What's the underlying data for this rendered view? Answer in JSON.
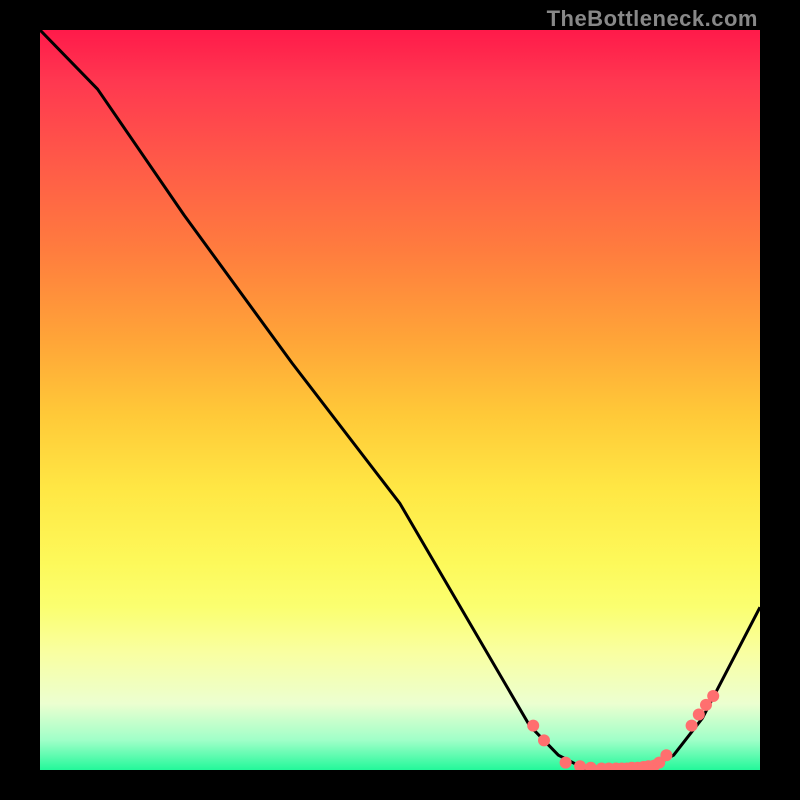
{
  "branding": "TheBottleneck.com",
  "chart_data": {
    "type": "line",
    "title": "",
    "xlabel": "",
    "ylabel": "",
    "xlim": [
      0,
      100
    ],
    "ylim": [
      0,
      100
    ],
    "series": [
      {
        "name": "bottleneck-curve",
        "x": [
          0,
          8,
          20,
          35,
          50,
          68,
          72,
          76,
          80,
          84,
          88,
          92,
          100
        ],
        "y": [
          100,
          92,
          75,
          55,
          36,
          6,
          2,
          0,
          0,
          0,
          2,
          7,
          22
        ]
      }
    ],
    "markers": {
      "name": "highlighted-points",
      "color": "#ff6f6f",
      "x": [
        68.5,
        70,
        73,
        75,
        76.5,
        78,
        79,
        80,
        80.8,
        81.5,
        82.2,
        83,
        83.8,
        84.5,
        85.3,
        86,
        87,
        90.5,
        91.5,
        92.5,
        93.5
      ],
      "y": [
        6,
        4,
        1,
        0.5,
        0.3,
        0.2,
        0.2,
        0.2,
        0.2,
        0.2,
        0.3,
        0.3,
        0.4,
        0.5,
        0.6,
        1,
        2,
        6,
        7.5,
        8.8,
        10
      ]
    }
  }
}
